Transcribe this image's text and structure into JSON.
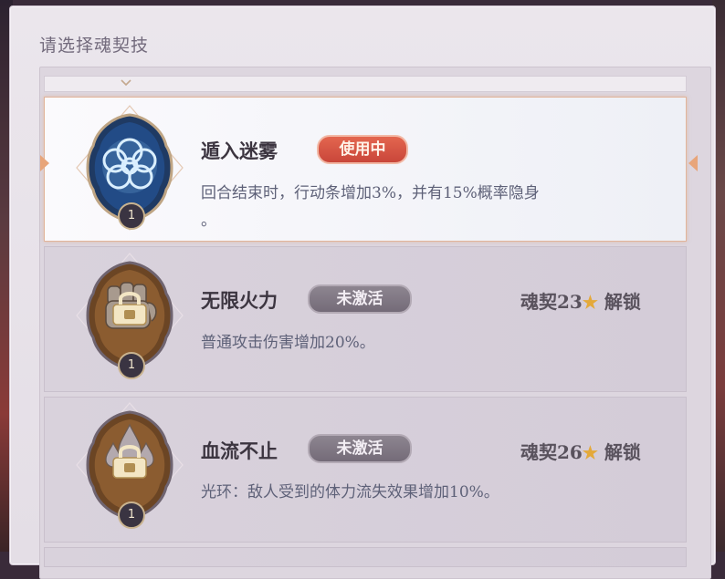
{
  "panel": {
    "title": "请选择魂契技"
  },
  "skills": [
    {
      "name": "遁入迷雾",
      "status": "使用中",
      "description_line1": "回合结束时，行动条增加3%，并有15%概率隐身",
      "description_line2": "。",
      "level": "1",
      "icon": "cloud-icon",
      "selected": true
    },
    {
      "name": "无限火力",
      "status": "未激活",
      "description_line1": "普通攻击伤害增加20%。",
      "level": "1",
      "icon": "fist-icon",
      "unlock_prefix": "魂契23",
      "unlock_suffix": "解锁",
      "star": "★"
    },
    {
      "name": "血流不止",
      "status": "未激活",
      "description_line1": "光环：敌人受到的体力流失效果增加10%。",
      "level": "1",
      "icon": "blood-drops-icon",
      "unlock_prefix": "魂契26",
      "unlock_suffix": "解锁",
      "star": "★"
    }
  ],
  "colors": {
    "active_tag": "#d2533f",
    "inactive_tag": "#827988",
    "star": "#e4a93a",
    "selected_border": "#e1b49a"
  }
}
